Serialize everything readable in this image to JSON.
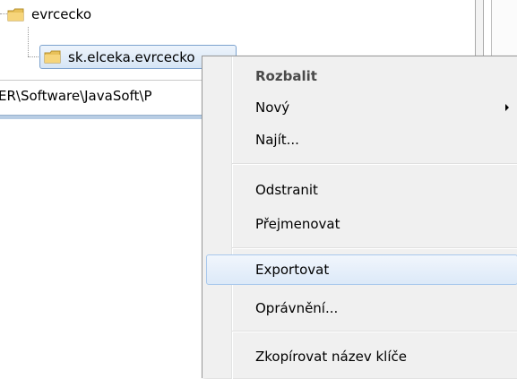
{
  "tree": {
    "parent_label": "evrcecko",
    "child_label": "sk.elceka.evrcecko"
  },
  "status_bar": {
    "path_text": "ER\\Software\\JavaSoft\\P"
  },
  "context_menu": {
    "items": [
      {
        "label": "Rozbalit",
        "bold": true
      },
      {
        "label": "Nový",
        "has_submenu": true
      },
      {
        "label": "Najít..."
      },
      {
        "label": "Odstranit"
      },
      {
        "label": "Přejmenovat"
      },
      {
        "label": "Exportovat",
        "highlighted": true
      },
      {
        "label": "Oprávnění..."
      },
      {
        "label": "Zkopírovat název klíče"
      }
    ]
  },
  "colors": {
    "highlight_border": "#a8c8ec",
    "folder_yellow": "#e8c15a",
    "menu_background": "#f0f0f0"
  }
}
